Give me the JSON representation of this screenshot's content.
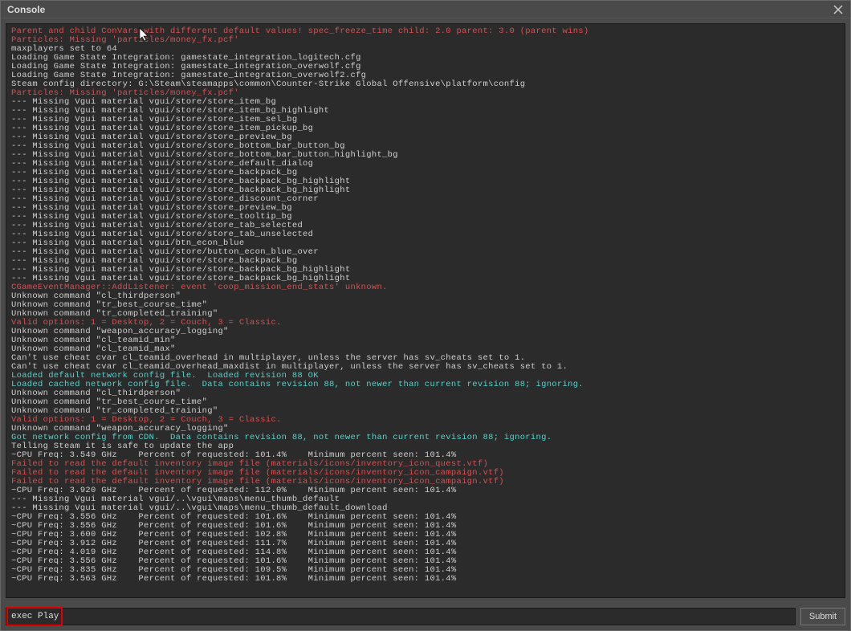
{
  "window": {
    "title": "Console",
    "close_icon": "×"
  },
  "input": {
    "value": "exec Play",
    "submit_label": "Submit"
  },
  "lines": [
    {
      "c": "red",
      "t": "Parent and child ConVars with different default values! spec_freeze_time child: 2.0 parent: 3.0 (parent wins)"
    },
    {
      "c": "red",
      "t": "Particles: Missing 'particles/money_fx.pcf'"
    },
    {
      "c": "default",
      "t": "maxplayers set to 64"
    },
    {
      "c": "default",
      "t": "Loading Game State Integration: gamestate_integration_logitech.cfg"
    },
    {
      "c": "default",
      "t": "Loading Game State Integration: gamestate_integration_overwolf.cfg"
    },
    {
      "c": "default",
      "t": "Loading Game State Integration: gamestate_integration_overwolf2.cfg"
    },
    {
      "c": "default",
      "t": "Steam config directory: G:\\Steam\\steamapps\\common\\Counter-Strike Global Offensive\\platform\\config"
    },
    {
      "c": "red",
      "t": "Particles: Missing 'particles/money_fx.pcf'"
    },
    {
      "c": "default",
      "t": "--- Missing Vgui material vgui/store/store_item_bg"
    },
    {
      "c": "default",
      "t": "--- Missing Vgui material vgui/store/store_item_bg_highlight"
    },
    {
      "c": "default",
      "t": "--- Missing Vgui material vgui/store/store_item_sel_bg"
    },
    {
      "c": "default",
      "t": "--- Missing Vgui material vgui/store/store_item_pickup_bg"
    },
    {
      "c": "default",
      "t": "--- Missing Vgui material vgui/store/store_preview_bg"
    },
    {
      "c": "default",
      "t": "--- Missing Vgui material vgui/store/store_bottom_bar_button_bg"
    },
    {
      "c": "default",
      "t": "--- Missing Vgui material vgui/store/store_bottom_bar_button_highlight_bg"
    },
    {
      "c": "default",
      "t": "--- Missing Vgui material vgui/store/store_default_dialog"
    },
    {
      "c": "default",
      "t": "--- Missing Vgui material vgui/store/store_backpack_bg"
    },
    {
      "c": "default",
      "t": "--- Missing Vgui material vgui/store/store_backpack_bg_highlight"
    },
    {
      "c": "default",
      "t": "--- Missing Vgui material vgui/store/store_backpack_bg_highlight"
    },
    {
      "c": "default",
      "t": "--- Missing Vgui material vgui/store/store_discount_corner"
    },
    {
      "c": "default",
      "t": "--- Missing Vgui material vgui/store/store_preview_bg"
    },
    {
      "c": "default",
      "t": "--- Missing Vgui material vgui/store/store_tooltip_bg"
    },
    {
      "c": "default",
      "t": "--- Missing Vgui material vgui/store/store_tab_selected"
    },
    {
      "c": "default",
      "t": "--- Missing Vgui material vgui/store/store_tab_unselected"
    },
    {
      "c": "default",
      "t": "--- Missing Vgui material vgui/btn_econ_blue"
    },
    {
      "c": "default",
      "t": "--- Missing Vgui material vgui/store/button_econ_blue_over"
    },
    {
      "c": "default",
      "t": "--- Missing Vgui material vgui/store/store_backpack_bg"
    },
    {
      "c": "default",
      "t": "--- Missing Vgui material vgui/store/store_backpack_bg_highlight"
    },
    {
      "c": "default",
      "t": "--- Missing Vgui material vgui/store/store_backpack_bg_highlight"
    },
    {
      "c": "red",
      "t": "CGameEventManager::AddListener: event 'coop_mission_end_stats' unknown."
    },
    {
      "c": "default",
      "t": "Unknown command \"cl_thirdperson\""
    },
    {
      "c": "default",
      "t": "Unknown command \"tr_best_course_time\""
    },
    {
      "c": "default",
      "t": "Unknown command \"tr_completed_training\""
    },
    {
      "c": "red",
      "t": "Valid options: 1 = Desktop, 2 = Couch, 3 = Classic."
    },
    {
      "c": "default",
      "t": "Unknown command \"weapon_accuracy_logging\""
    },
    {
      "c": "default",
      "t": "Unknown command \"cl_teamid_min\""
    },
    {
      "c": "default",
      "t": "Unknown command \"cl_teamid_max\""
    },
    {
      "c": "default",
      "t": "Can't use cheat cvar cl_teamid_overhead in multiplayer, unless the server has sv_cheats set to 1."
    },
    {
      "c": "default",
      "t": "Can't use cheat cvar cl_teamid_overhead_maxdist in multiplayer, unless the server has sv_cheats set to 1."
    },
    {
      "c": "cyan",
      "t": "Loaded default network config file.  Loaded revision 88 OK"
    },
    {
      "c": "cyan",
      "t": "Loaded cached network config file.  Data contains revision 88, not newer than current revision 88; ignoring."
    },
    {
      "c": "default",
      "t": "Unknown command \"cl_thirdperson\""
    },
    {
      "c": "default",
      "t": "Unknown command \"tr_best_course_time\""
    },
    {
      "c": "default",
      "t": "Unknown command \"tr_completed_training\""
    },
    {
      "c": "red",
      "t": "Valid options: 1 = Desktop, 2 = Couch, 3 = Classic."
    },
    {
      "c": "default",
      "t": "Unknown command \"weapon_accuracy_logging\""
    },
    {
      "c": "cyan",
      "t": "Got network config from CDN.  Data contains revision 88, not newer than current revision 88; ignoring."
    },
    {
      "c": "default",
      "t": "Telling Steam it is safe to update the app"
    },
    {
      "c": "default",
      "t": "~CPU Freq: 3.549 GHz    Percent of requested: 101.4%    Minimum percent seen: 101.4%"
    },
    {
      "c": "red",
      "t": "Failed to read the default inventory image file (materials/icons/inventory_icon_quest.vtf)"
    },
    {
      "c": "red",
      "t": "Failed to read the default inventory image file (materials/icons/inventory_icon_campaign.vtf)"
    },
    {
      "c": "red",
      "t": "Failed to read the default inventory image file (materials/icons/inventory_icon_campaign.vtf)"
    },
    {
      "c": "default",
      "t": "~CPU Freq: 3.920 GHz    Percent of requested: 112.0%    Minimum percent seen: 101.4%"
    },
    {
      "c": "default",
      "t": "--- Missing Vgui material vgui/..\\vgui\\maps\\menu_thumb_default"
    },
    {
      "c": "default",
      "t": "--- Missing Vgui material vgui/..\\vgui\\maps\\menu_thumb_default_download"
    },
    {
      "c": "default",
      "t": "~CPU Freq: 3.556 GHz    Percent of requested: 101.6%    Minimum percent seen: 101.4%"
    },
    {
      "c": "default",
      "t": "~CPU Freq: 3.556 GHz    Percent of requested: 101.6%    Minimum percent seen: 101.4%"
    },
    {
      "c": "default",
      "t": "~CPU Freq: 3.600 GHz    Percent of requested: 102.8%    Minimum percent seen: 101.4%"
    },
    {
      "c": "default",
      "t": "~CPU Freq: 3.912 GHz    Percent of requested: 111.7%    Minimum percent seen: 101.4%"
    },
    {
      "c": "default",
      "t": "~CPU Freq: 4.019 GHz    Percent of requested: 114.8%    Minimum percent seen: 101.4%"
    },
    {
      "c": "default",
      "t": "~CPU Freq: 3.556 GHz    Percent of requested: 101.6%    Minimum percent seen: 101.4%"
    },
    {
      "c": "default",
      "t": "~CPU Freq: 3.835 GHz    Percent of requested: 109.5%    Minimum percent seen: 101.4%"
    },
    {
      "c": "default",
      "t": "~CPU Freq: 3.563 GHz    Percent of requested: 101.8%    Minimum percent seen: 101.4%"
    }
  ]
}
